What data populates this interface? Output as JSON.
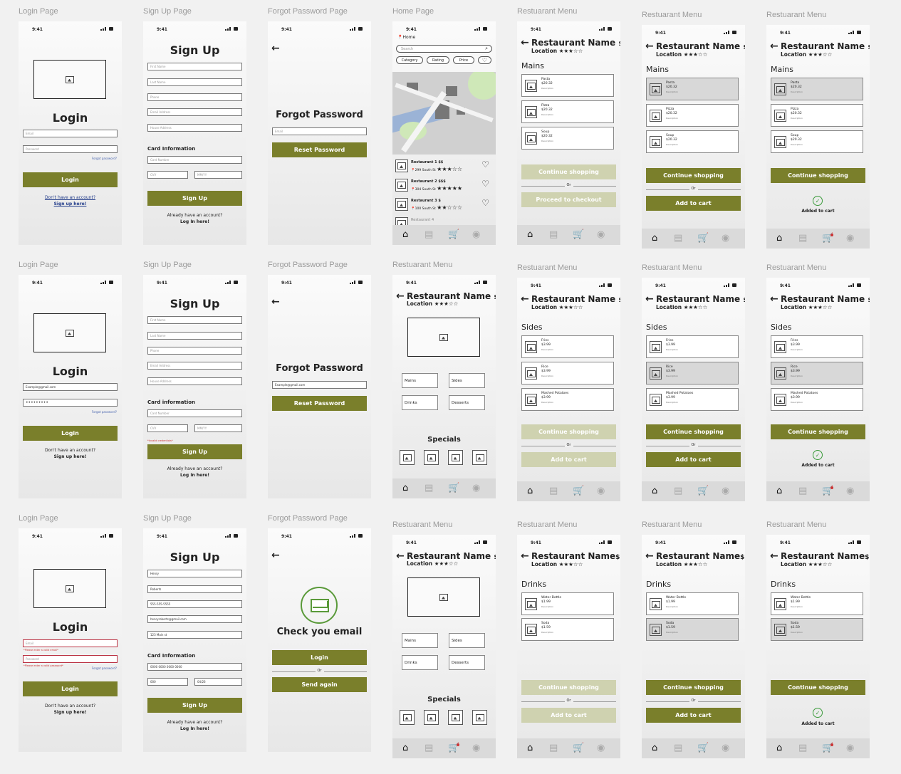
{
  "status_time": "9:41",
  "frame_labels": {
    "login": "Login Page",
    "signup": "Sign Up Page",
    "forgot": "Forgot Password Page",
    "home": "Home Page",
    "menu": "Restuarant Menu"
  },
  "login": {
    "title": "Login",
    "email_ph": "Email",
    "password_ph": "Password",
    "forgot": "Forgot password?",
    "button": "Login",
    "no_account": "Don't have an account?",
    "signup_here": "Sign up here!",
    "email_value": "Example@gmail.com",
    "password_value": "•••••••••",
    "email_error": "*Please enter a valid email*",
    "password_error": "*Please enter a valid password*"
  },
  "signup": {
    "title": "Sign Up",
    "fields": [
      "First Name",
      "Last Name",
      "Phone",
      "Email Address",
      "House Address"
    ],
    "filled": [
      "Henry",
      "Roberts",
      "555-555-5555",
      "henryroberts@gmail.com",
      "123 Main st"
    ],
    "card_heading1": "Card Information",
    "card_heading2": "Card information",
    "card_number_ph": "Card Number",
    "cvv_ph": "CVV",
    "expiry_ph": "MM/YY",
    "card_number_val": "0000 0000 0000 0000",
    "cvv_val": "000",
    "expiry_val": "04/26",
    "invalid": "*Invalid credentials*",
    "button": "Sign Up",
    "have_account": "Already have an account?",
    "login_here": "Log In here!"
  },
  "forgot": {
    "title": "Forgot Password",
    "email_ph": "Email",
    "email_value": "Example@gmail.com",
    "button": "Reset Password",
    "check_title": "Check you email",
    "login": "Login",
    "or": "Or",
    "send_again": "Send again"
  },
  "home": {
    "location": "Home",
    "search_ph": "Search",
    "chips": [
      "Category",
      "Rating",
      "Price"
    ],
    "restaurants": [
      {
        "name": "Restaurant 1",
        "price": "$$",
        "addr": "299 South St",
        "stars": "★★★☆☆"
      },
      {
        "name": "Restaurant 2",
        "price": "$$$",
        "addr": "304 South St",
        "stars": "★★★★★"
      },
      {
        "name": "Restaurant 3",
        "price": "$",
        "addr": "100 South St",
        "stars": "★★☆☆☆"
      },
      {
        "name": "Restaurant 4",
        "price": "",
        "addr": "",
        "stars": ""
      }
    ]
  },
  "menu": {
    "name": "Restaurant Name",
    "price": "$$",
    "location": "Location",
    "stars": "★★★☆☆",
    "categories": [
      "Mains",
      "Sides",
      "Drinks",
      "Desserts"
    ],
    "specials": "Specials",
    "continue": "Continue shopping",
    "or": "Or",
    "checkout": "Proceed to checkout",
    "add": "Add to cart",
    "added": "Added to cart",
    "mains": [
      {
        "name": "Pasta",
        "price": "$20.32"
      },
      {
        "name": "Pizza",
        "price": "$20.32"
      },
      {
        "name": "Soup",
        "price": "$20.32"
      }
    ],
    "sides": [
      {
        "name": "Fries",
        "price": "$3.99"
      },
      {
        "name": "Rice",
        "price": "$3.99"
      },
      {
        "name": "Mashed Potatoes",
        "price": "$3.99"
      }
    ],
    "drinks": [
      {
        "name": "Water Bottle",
        "price": "$1.99"
      },
      {
        "name": "Soda",
        "price": "$1.59"
      }
    ],
    "desc": "Description"
  }
}
